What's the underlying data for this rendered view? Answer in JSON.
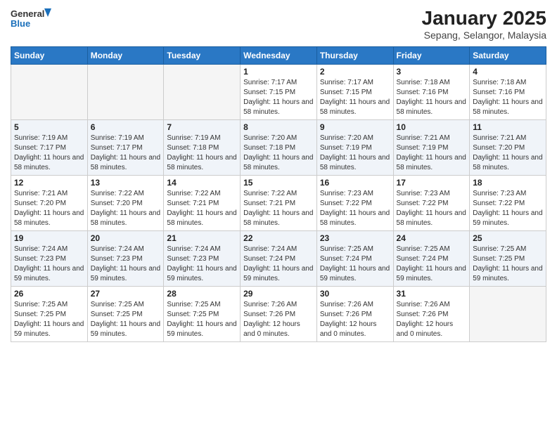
{
  "header": {
    "logo_general": "General",
    "logo_blue": "Blue",
    "month_year": "January 2025",
    "location": "Sepang, Selangor, Malaysia"
  },
  "weekdays": [
    "Sunday",
    "Monday",
    "Tuesday",
    "Wednesday",
    "Thursday",
    "Friday",
    "Saturday"
  ],
  "weeks": [
    [
      {
        "day": "",
        "sunrise": "",
        "sunset": "",
        "daylight": ""
      },
      {
        "day": "",
        "sunrise": "",
        "sunset": "",
        "daylight": ""
      },
      {
        "day": "",
        "sunrise": "",
        "sunset": "",
        "daylight": ""
      },
      {
        "day": "1",
        "sunrise": "Sunrise: 7:17 AM",
        "sunset": "Sunset: 7:15 PM",
        "daylight": "Daylight: 11 hours and 58 minutes."
      },
      {
        "day": "2",
        "sunrise": "Sunrise: 7:17 AM",
        "sunset": "Sunset: 7:15 PM",
        "daylight": "Daylight: 11 hours and 58 minutes."
      },
      {
        "day": "3",
        "sunrise": "Sunrise: 7:18 AM",
        "sunset": "Sunset: 7:16 PM",
        "daylight": "Daylight: 11 hours and 58 minutes."
      },
      {
        "day": "4",
        "sunrise": "Sunrise: 7:18 AM",
        "sunset": "Sunset: 7:16 PM",
        "daylight": "Daylight: 11 hours and 58 minutes."
      }
    ],
    [
      {
        "day": "5",
        "sunrise": "Sunrise: 7:19 AM",
        "sunset": "Sunset: 7:17 PM",
        "daylight": "Daylight: 11 hours and 58 minutes."
      },
      {
        "day": "6",
        "sunrise": "Sunrise: 7:19 AM",
        "sunset": "Sunset: 7:17 PM",
        "daylight": "Daylight: 11 hours and 58 minutes."
      },
      {
        "day": "7",
        "sunrise": "Sunrise: 7:19 AM",
        "sunset": "Sunset: 7:18 PM",
        "daylight": "Daylight: 11 hours and 58 minutes."
      },
      {
        "day": "8",
        "sunrise": "Sunrise: 7:20 AM",
        "sunset": "Sunset: 7:18 PM",
        "daylight": "Daylight: 11 hours and 58 minutes."
      },
      {
        "day": "9",
        "sunrise": "Sunrise: 7:20 AM",
        "sunset": "Sunset: 7:19 PM",
        "daylight": "Daylight: 11 hours and 58 minutes."
      },
      {
        "day": "10",
        "sunrise": "Sunrise: 7:21 AM",
        "sunset": "Sunset: 7:19 PM",
        "daylight": "Daylight: 11 hours and 58 minutes."
      },
      {
        "day": "11",
        "sunrise": "Sunrise: 7:21 AM",
        "sunset": "Sunset: 7:20 PM",
        "daylight": "Daylight: 11 hours and 58 minutes."
      }
    ],
    [
      {
        "day": "12",
        "sunrise": "Sunrise: 7:21 AM",
        "sunset": "Sunset: 7:20 PM",
        "daylight": "Daylight: 11 hours and 58 minutes."
      },
      {
        "day": "13",
        "sunrise": "Sunrise: 7:22 AM",
        "sunset": "Sunset: 7:20 PM",
        "daylight": "Daylight: 11 hours and 58 minutes."
      },
      {
        "day": "14",
        "sunrise": "Sunrise: 7:22 AM",
        "sunset": "Sunset: 7:21 PM",
        "daylight": "Daylight: 11 hours and 58 minutes."
      },
      {
        "day": "15",
        "sunrise": "Sunrise: 7:22 AM",
        "sunset": "Sunset: 7:21 PM",
        "daylight": "Daylight: 11 hours and 58 minutes."
      },
      {
        "day": "16",
        "sunrise": "Sunrise: 7:23 AM",
        "sunset": "Sunset: 7:22 PM",
        "daylight": "Daylight: 11 hours and 58 minutes."
      },
      {
        "day": "17",
        "sunrise": "Sunrise: 7:23 AM",
        "sunset": "Sunset: 7:22 PM",
        "daylight": "Daylight: 11 hours and 58 minutes."
      },
      {
        "day": "18",
        "sunrise": "Sunrise: 7:23 AM",
        "sunset": "Sunset: 7:22 PM",
        "daylight": "Daylight: 11 hours and 59 minutes."
      }
    ],
    [
      {
        "day": "19",
        "sunrise": "Sunrise: 7:24 AM",
        "sunset": "Sunset: 7:23 PM",
        "daylight": "Daylight: 11 hours and 59 minutes."
      },
      {
        "day": "20",
        "sunrise": "Sunrise: 7:24 AM",
        "sunset": "Sunset: 7:23 PM",
        "daylight": "Daylight: 11 hours and 59 minutes."
      },
      {
        "day": "21",
        "sunrise": "Sunrise: 7:24 AM",
        "sunset": "Sunset: 7:23 PM",
        "daylight": "Daylight: 11 hours and 59 minutes."
      },
      {
        "day": "22",
        "sunrise": "Sunrise: 7:24 AM",
        "sunset": "Sunset: 7:24 PM",
        "daylight": "Daylight: 11 hours and 59 minutes."
      },
      {
        "day": "23",
        "sunrise": "Sunrise: 7:25 AM",
        "sunset": "Sunset: 7:24 PM",
        "daylight": "Daylight: 11 hours and 59 minutes."
      },
      {
        "day": "24",
        "sunrise": "Sunrise: 7:25 AM",
        "sunset": "Sunset: 7:24 PM",
        "daylight": "Daylight: 11 hours and 59 minutes."
      },
      {
        "day": "25",
        "sunrise": "Sunrise: 7:25 AM",
        "sunset": "Sunset: 7:25 PM",
        "daylight": "Daylight: 11 hours and 59 minutes."
      }
    ],
    [
      {
        "day": "26",
        "sunrise": "Sunrise: 7:25 AM",
        "sunset": "Sunset: 7:25 PM",
        "daylight": "Daylight: 11 hours and 59 minutes."
      },
      {
        "day": "27",
        "sunrise": "Sunrise: 7:25 AM",
        "sunset": "Sunset: 7:25 PM",
        "daylight": "Daylight: 11 hours and 59 minutes."
      },
      {
        "day": "28",
        "sunrise": "Sunrise: 7:25 AM",
        "sunset": "Sunset: 7:25 PM",
        "daylight": "Daylight: 11 hours and 59 minutes."
      },
      {
        "day": "29",
        "sunrise": "Sunrise: 7:26 AM",
        "sunset": "Sunset: 7:26 PM",
        "daylight": "Daylight: 12 hours and 0 minutes."
      },
      {
        "day": "30",
        "sunrise": "Sunrise: 7:26 AM",
        "sunset": "Sunset: 7:26 PM",
        "daylight": "Daylight: 12 hours and 0 minutes."
      },
      {
        "day": "31",
        "sunrise": "Sunrise: 7:26 AM",
        "sunset": "Sunset: 7:26 PM",
        "daylight": "Daylight: 12 hours and 0 minutes."
      },
      {
        "day": "",
        "sunrise": "",
        "sunset": "",
        "daylight": ""
      }
    ]
  ]
}
